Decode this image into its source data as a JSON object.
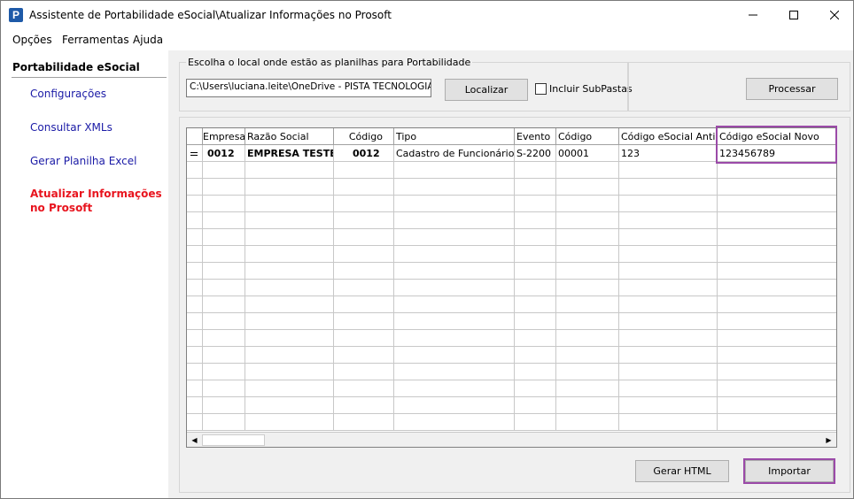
{
  "window": {
    "title": "Assistente de Portabilidade eSocial\\Atualizar Informações no Prosoft",
    "app_icon_letter": "P"
  },
  "menu": {
    "items": [
      "Opções",
      "Ferramentas",
      "Ajuda"
    ]
  },
  "sidebar": {
    "header": "Portabilidade eSocial",
    "items": [
      {
        "label": "Configurações"
      },
      {
        "label": "Consultar XMLs"
      },
      {
        "label": "Gerar Planilha Excel"
      },
      {
        "label": "Atualizar Informações no Prosoft",
        "active": true
      }
    ]
  },
  "source": {
    "legend": "Escolha o local onde estão as planilhas para Portabilidade",
    "path_value": "C:\\Users\\luciana.leite\\OneDrive - PISTA TECNOLOGIA S.",
    "locate_button": "Localizar",
    "subfolders_label": "Incluir SubPastas",
    "subfolders_checked": false,
    "process_button": "Processar"
  },
  "grid": {
    "columns": [
      "Empresa",
      "Razão Social",
      "Código",
      "Tipo",
      "Evento",
      "Código",
      "Código eSocial Antigo",
      "Código eSocial Novo"
    ],
    "rows": [
      [
        "0012",
        "EMPRESA TESTE",
        "0012",
        "Cadastro de Funcionários",
        "S-2200",
        "00001",
        "123",
        "123456789"
      ]
    ]
  },
  "actions": {
    "html_button": "Gerar HTML",
    "import_button": "Importar"
  },
  "colors": {
    "highlight": "#9b4aa8",
    "active_link": "#e8141e",
    "link": "#1a1aa6"
  }
}
